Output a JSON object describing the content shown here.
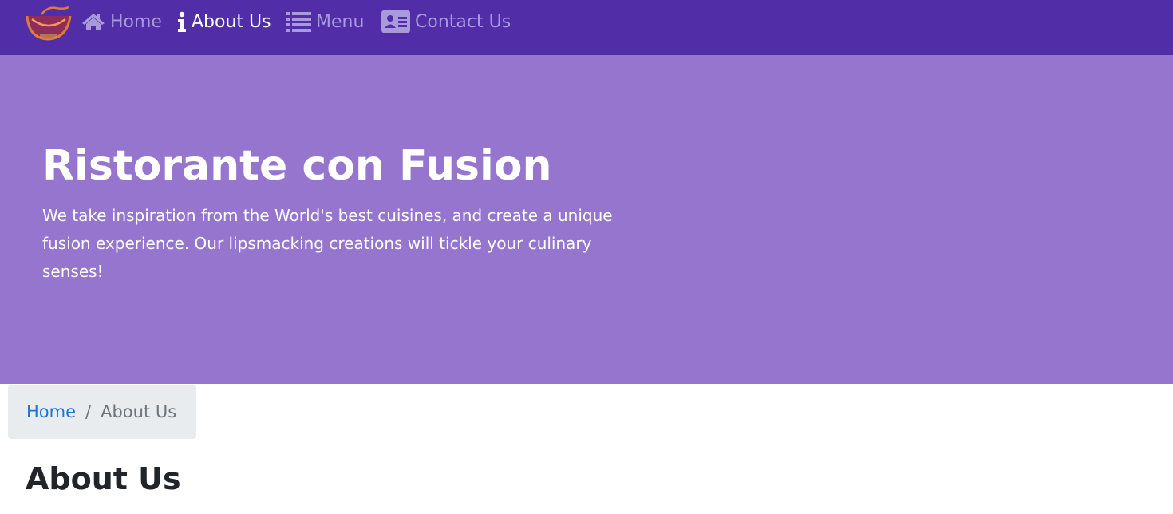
{
  "colors": {
    "navbar_bg": "#512DA8",
    "jumbotron_bg": "#9575CD",
    "nav_inactive": "#A99BDB",
    "nav_active": "#FFFFFF",
    "link": "#1976D2",
    "breadcrumb_bg": "#E9ECEF"
  },
  "navbar": {
    "logo_icon": "restaurant-logo",
    "items": [
      {
        "label": "Home",
        "icon": "home-icon",
        "active": false
      },
      {
        "label": "About Us",
        "icon": "info-icon",
        "active": true
      },
      {
        "label": "Menu",
        "icon": "list-icon",
        "active": false
      },
      {
        "label": "Contact Us",
        "icon": "address-card-icon",
        "active": false
      }
    ]
  },
  "jumbotron": {
    "title": "Ristorante con Fusion",
    "text": "We take inspiration from the World's best cuisines, and create a unique fusion experience. Our lipsmacking creations will tickle your culinary senses!"
  },
  "breadcrumb": {
    "home": "Home",
    "separator": "/",
    "current": "About Us"
  },
  "page": {
    "heading": "About Us"
  }
}
